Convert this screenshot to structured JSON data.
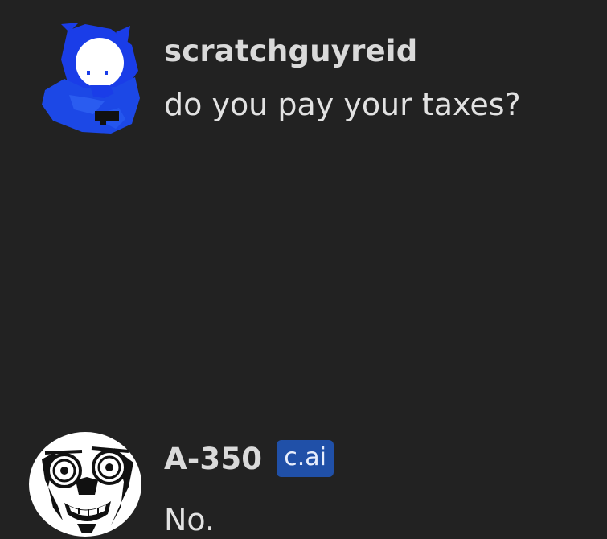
{
  "messages": [
    {
      "author": "scratchguyreid",
      "text": "do you pay your taxes?",
      "avatar_icon": "blue-cat-avatar-icon",
      "badge": ""
    },
    {
      "author": "A-350",
      "text": "No.",
      "avatar_icon": "staring-face-avatar-icon",
      "badge": "c.ai"
    }
  ],
  "colors": {
    "background": "#222222",
    "author_text": "#dadada",
    "message_text": "#e2e2e2",
    "badge_background": "#2050a8",
    "avatar_1_blue": "#1a40e8"
  }
}
